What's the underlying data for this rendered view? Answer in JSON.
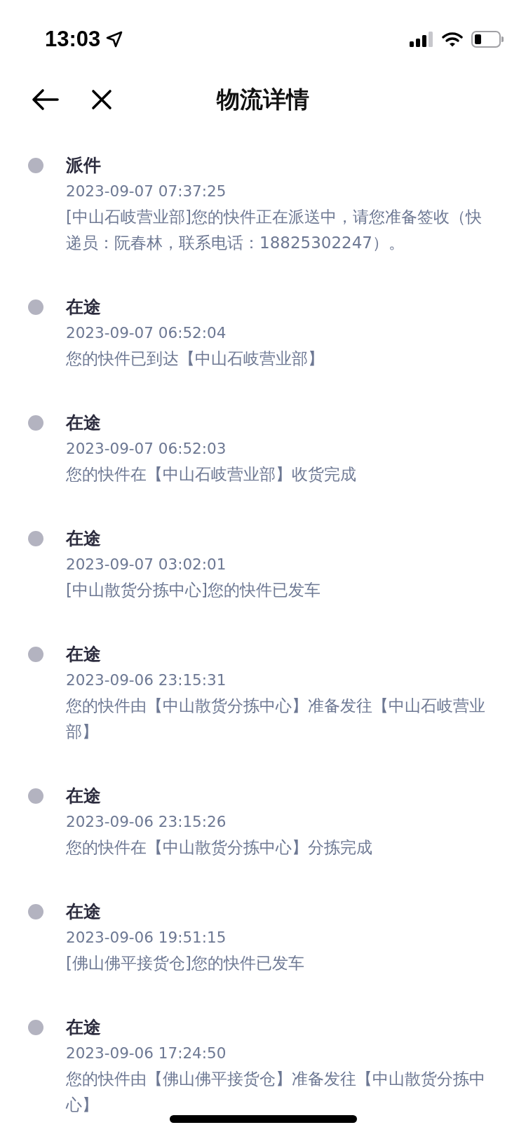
{
  "status_bar": {
    "time": "13:03"
  },
  "nav": {
    "title": "物流详情"
  },
  "events": [
    {
      "status": "派件",
      "time": "2023-09-07 07:37:25",
      "detail": "[中山石岐营业部]您的快件正在派送中，请您准备签收（快递员：阮春林，联系电话：18825302247）。"
    },
    {
      "status": "在途",
      "time": "2023-09-07 06:52:04",
      "detail": "您的快件已到达【中山石岐营业部】"
    },
    {
      "status": "在途",
      "time": "2023-09-07 06:52:03",
      "detail": "您的快件在【中山石岐营业部】收货完成"
    },
    {
      "status": "在途",
      "time": "2023-09-07 03:02:01",
      "detail": "[中山散货分拣中心]您的快件已发车"
    },
    {
      "status": "在途",
      "time": "2023-09-06 23:15:31",
      "detail": "您的快件由【中山散货分拣中心】准备发往【中山石岐营业部】"
    },
    {
      "status": "在途",
      "time": "2023-09-06 23:15:26",
      "detail": "您的快件在【中山散货分拣中心】分拣完成"
    },
    {
      "status": "在途",
      "time": "2023-09-06 19:51:15",
      "detail": "[佛山佛平接货仓]您的快件已发车"
    },
    {
      "status": "在途",
      "time": "2023-09-06 17:24:50",
      "detail": "您的快件由【佛山佛平接货仓】准备发往【中山散货分拣中心】"
    }
  ]
}
